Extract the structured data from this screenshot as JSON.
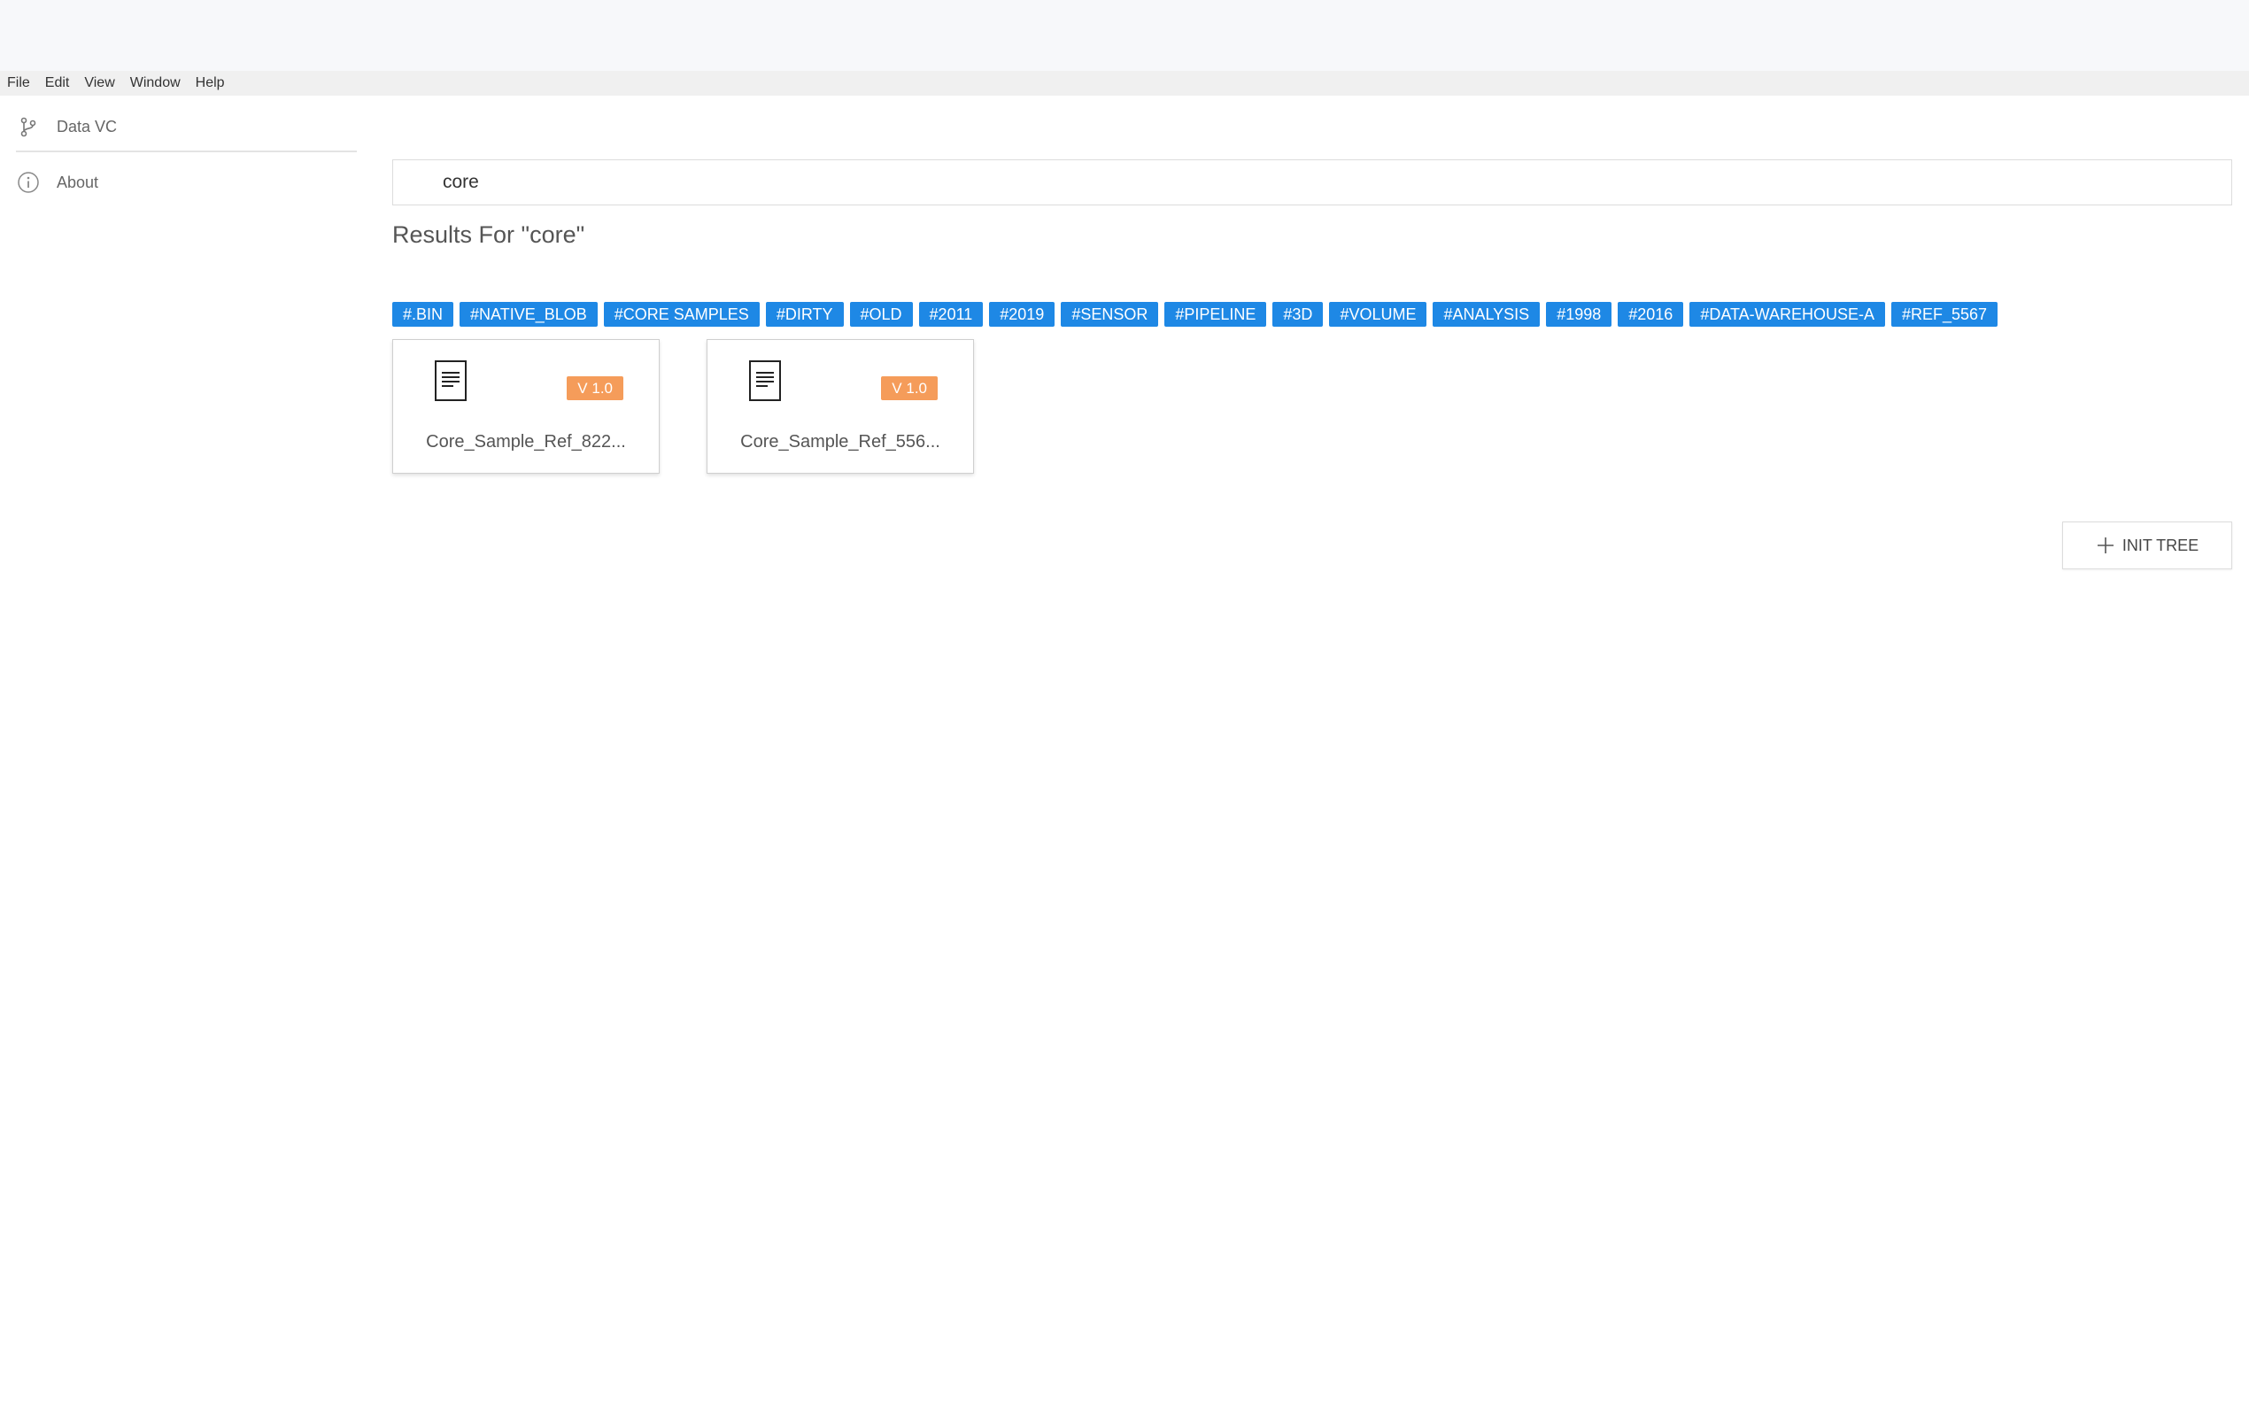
{
  "menu": {
    "items": [
      "File",
      "Edit",
      "View",
      "Window",
      "Help"
    ]
  },
  "sidebar": {
    "items": [
      {
        "label": "Data VC",
        "icon": "branch-icon"
      },
      {
        "label": "About",
        "icon": "info-icon"
      }
    ]
  },
  "search": {
    "value": "core"
  },
  "results": {
    "heading": "Results For \"core\""
  },
  "tags": [
    "#.BIN",
    "#NATIVE_BLOB",
    "#CORE SAMPLES",
    "#DIRTY",
    "#OLD",
    "#2011",
    "#2019",
    "#SENSOR",
    "#PIPELINE",
    "#3D",
    "#VOLUME",
    "#ANALYSIS",
    "#1998",
    "#2016",
    "#DATA-WAREHOUSE-A",
    "#REF_5567"
  ],
  "cards": [
    {
      "name": "Core_Sample_Ref_822...",
      "version": "V 1.0",
      "icon": "document-icon"
    },
    {
      "name": "Core_Sample_Ref_556...",
      "version": "V 1.0",
      "icon": "document-icon"
    }
  ],
  "actions": {
    "init_tree_label": "INIT TREE"
  },
  "colors": {
    "tag": "#1e88e5",
    "version_badge": "#f59c5a"
  }
}
